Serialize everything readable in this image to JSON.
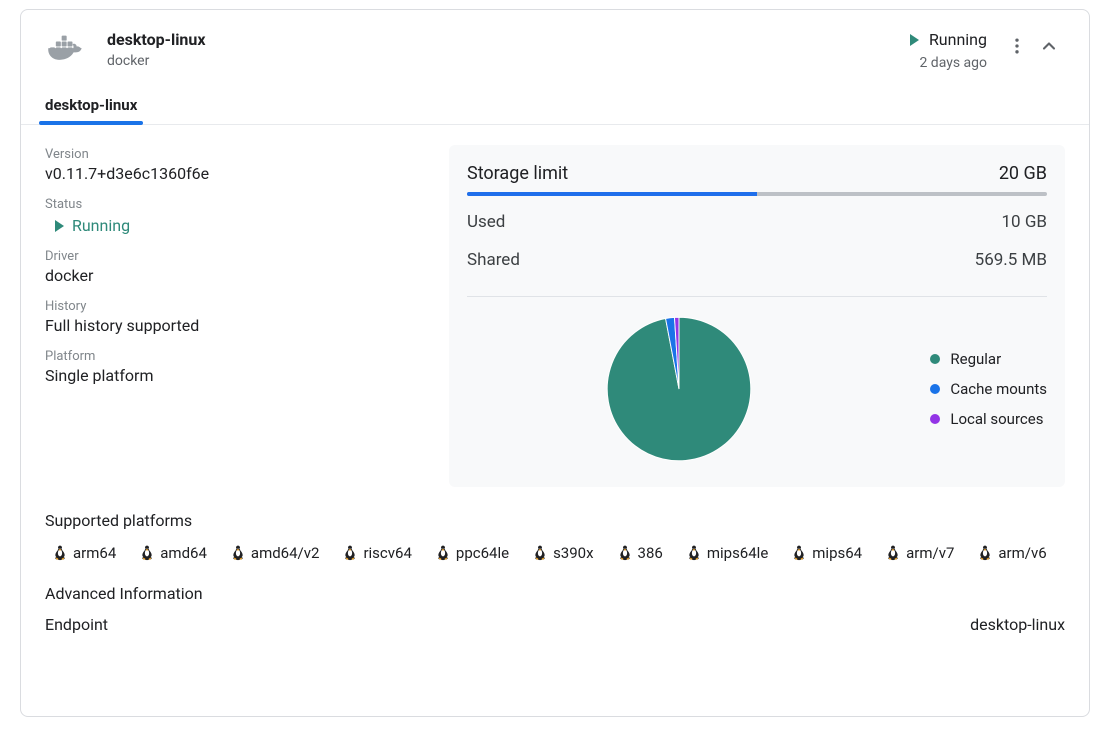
{
  "header": {
    "title": "desktop-linux",
    "driver": "docker",
    "status": "Running",
    "age": "2 days ago"
  },
  "tab": {
    "label": "desktop-linux"
  },
  "meta": {
    "version_label": "Version",
    "version": "v0.11.7+d3e6c1360f6e",
    "status_label": "Status",
    "status": "Running",
    "driver_label": "Driver",
    "driver": "docker",
    "history_label": "History",
    "history": "Full history supported",
    "platform_label": "Platform",
    "platform": "Single platform"
  },
  "storage": {
    "limit_label": "Storage limit",
    "limit": "20 GB",
    "used_label": "Used",
    "used": "10 GB",
    "shared_label": "Shared",
    "shared": "569.5 MB",
    "fill_pct": 50,
    "legend": {
      "regular": "Regular",
      "cache": "Cache mounts",
      "local": "Local sources"
    }
  },
  "platforms": {
    "title": "Supported platforms",
    "items": [
      "arm64",
      "amd64",
      "amd64/v2",
      "riscv64",
      "ppc64le",
      "s390x",
      "386",
      "mips64le",
      "mips64",
      "arm/v7",
      "arm/v6"
    ]
  },
  "advanced": {
    "title": "Advanced Information",
    "endpoint_label": "Endpoint",
    "endpoint": "desktop-linux"
  },
  "colors": {
    "teal": "#2f8a7a",
    "blue": "#1a73e8",
    "purple": "#9334e6"
  },
  "chart_data": {
    "type": "pie",
    "title": "",
    "series": [
      {
        "name": "Regular",
        "value": 97,
        "color": "#2f8a7a"
      },
      {
        "name": "Cache mounts",
        "value": 2,
        "color": "#1a73e8"
      },
      {
        "name": "Local sources",
        "value": 1,
        "color": "#9334e6"
      }
    ]
  }
}
